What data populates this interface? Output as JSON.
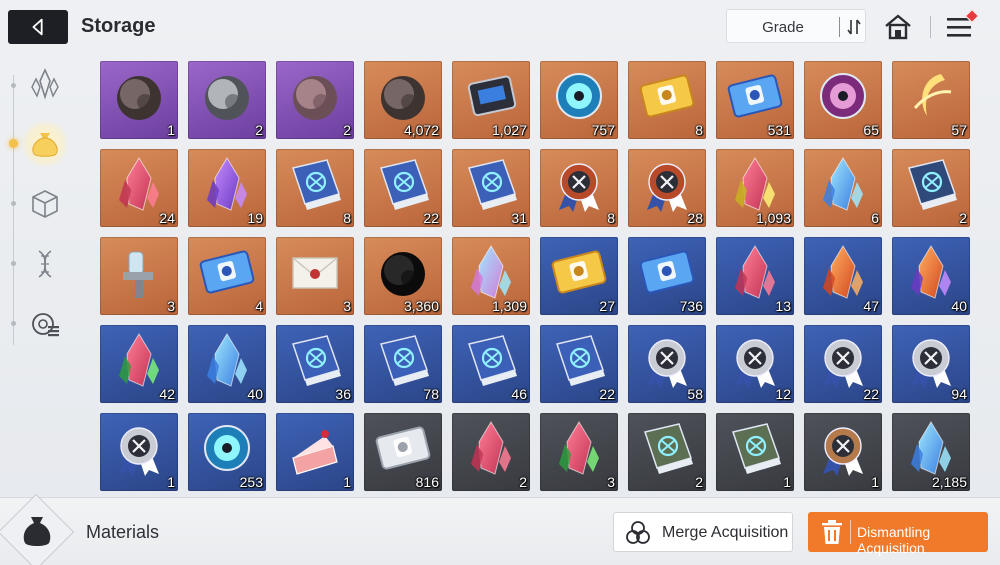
{
  "header": {
    "title": "Storage",
    "sort_label": "Grade"
  },
  "sidebar": {
    "items": [
      {
        "name": "crystal-category",
        "icon": "crystal-icon",
        "active": false
      },
      {
        "name": "materials-category",
        "icon": "money-bag-icon",
        "active": true
      },
      {
        "name": "box-category",
        "icon": "cube-icon",
        "active": false
      },
      {
        "name": "gene-category",
        "icon": "dna-icon",
        "active": false
      },
      {
        "name": "chip-category",
        "icon": "chip-list-icon",
        "active": false
      }
    ]
  },
  "inventory": {
    "rows": [
      [
        {
          "icon": "brain-ore",
          "grade": "purple",
          "count": "1"
        },
        {
          "icon": "metal-ore",
          "grade": "purple",
          "count": "2"
        },
        {
          "icon": "rock-face-ore",
          "grade": "purple",
          "count": "2"
        },
        {
          "icon": "blue-flower-core",
          "grade": "orange",
          "count": "4,072"
        },
        {
          "icon": "chip-module",
          "grade": "orange",
          "count": "1,027"
        },
        {
          "icon": "cyan-orb-capsule",
          "grade": "orange",
          "count": "757"
        },
        {
          "icon": "gold-ticket",
          "grade": "orange",
          "count": "8"
        },
        {
          "icon": "prism-ticket",
          "grade": "orange",
          "count": "531"
        },
        {
          "icon": "purple-eye-orb",
          "grade": "orange",
          "count": "65"
        },
        {
          "icon": "gold-feather-moon",
          "grade": "orange",
          "count": "57"
        }
      ],
      [
        {
          "icon": "red-crystal",
          "grade": "orange",
          "count": "24"
        },
        {
          "icon": "purple-crystal",
          "grade": "orange",
          "count": "19"
        },
        {
          "icon": "sword-book",
          "grade": "orange",
          "count": "8"
        },
        {
          "icon": "eye-book",
          "grade": "orange",
          "count": "22"
        },
        {
          "icon": "cross-book",
          "grade": "orange",
          "count": "31"
        },
        {
          "icon": "sun-medal",
          "grade": "orange",
          "count": "8"
        },
        {
          "icon": "cross-medal",
          "grade": "orange",
          "count": "28"
        },
        {
          "icon": "gold-shards",
          "grade": "orange",
          "count": "1,093"
        },
        {
          "icon": "blue-cube-crystal",
          "grade": "orange",
          "count": "6"
        },
        {
          "icon": "star-book",
          "grade": "orange",
          "count": "2"
        }
      ],
      [
        {
          "icon": "spray-gun",
          "grade": "orange",
          "count": "3"
        },
        {
          "icon": "card-deck",
          "grade": "orange",
          "count": "4"
        },
        {
          "icon": "sealed-letter",
          "grade": "orange",
          "count": "3"
        },
        {
          "icon": "black-spike-ball",
          "grade": "orange",
          "count": "3,360"
        },
        {
          "icon": "rainbow-crystal",
          "grade": "orange",
          "count": "1,309"
        },
        {
          "icon": "gold-keycard",
          "grade": "blue",
          "count": "27"
        },
        {
          "icon": "compass-keycard",
          "grade": "blue",
          "count": "736"
        },
        {
          "icon": "red-shard",
          "grade": "blue",
          "count": "13"
        },
        {
          "icon": "orange-shard",
          "grade": "blue",
          "count": "47"
        },
        {
          "icon": "violet-shard",
          "grade": "blue",
          "count": "40"
        }
      ],
      [
        {
          "icon": "green-shard",
          "grade": "blue",
          "count": "42"
        },
        {
          "icon": "cyan-shard",
          "grade": "blue",
          "count": "40"
        },
        {
          "icon": "sword-book-blue",
          "grade": "blue",
          "count": "36"
        },
        {
          "icon": "wing-book",
          "grade": "blue",
          "count": "78"
        },
        {
          "icon": "target-book",
          "grade": "blue",
          "count": "46"
        },
        {
          "icon": "globe-book",
          "grade": "blue",
          "count": "22"
        },
        {
          "icon": "cross-badge",
          "grade": "blue",
          "count": "58"
        },
        {
          "icon": "shield-badge",
          "grade": "blue",
          "count": "12"
        },
        {
          "icon": "square-badge",
          "grade": "blue",
          "count": "22"
        },
        {
          "icon": "x-badge",
          "grade": "blue",
          "count": "94"
        }
      ],
      [
        {
          "icon": "globe-badge",
          "grade": "blue",
          "count": "1"
        },
        {
          "icon": "ice-orb",
          "grade": "blue",
          "count": "253"
        },
        {
          "icon": "cake-slice",
          "grade": "blue",
          "count": "1"
        },
        {
          "icon": "silver-card",
          "grade": "gray",
          "count": "816"
        },
        {
          "icon": "pink-gem",
          "grade": "gray",
          "count": "2"
        },
        {
          "icon": "green-gem",
          "grade": "gray",
          "count": "3"
        },
        {
          "icon": "shield-book-gray",
          "grade": "gray",
          "count": "2"
        },
        {
          "icon": "x-book-gray",
          "grade": "gray",
          "count": "1"
        },
        {
          "icon": "bronze-badge",
          "grade": "gray",
          "count": "1"
        },
        {
          "icon": "blue-ice-crystal",
          "grade": "gray",
          "count": "2,185"
        }
      ]
    ]
  },
  "footer": {
    "category_label": "Materials",
    "merge_label": "Merge Acquisition",
    "dismantle_label": "Dismantling Acquisition"
  },
  "colors": {
    "accent": "#f07a2a",
    "active_tab": "#f3c14a",
    "orange_grade": "#c97346",
    "purple_grade": "#8555b8",
    "blue_grade": "#3553a3",
    "gray_grade": "#45484e"
  }
}
